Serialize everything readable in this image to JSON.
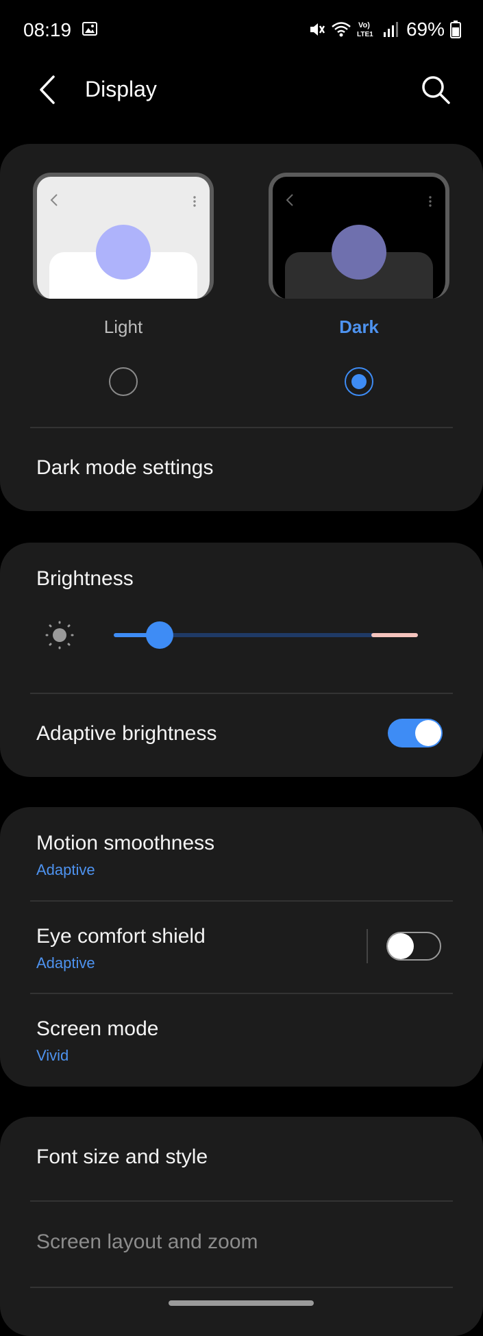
{
  "status_bar": {
    "time": "08:19",
    "battery": "69%",
    "network": "LTE1",
    "icons": [
      "gallery-icon",
      "mute-icon",
      "wifi-icon",
      "volte-icon",
      "signal-icon",
      "battery-icon"
    ]
  },
  "header": {
    "title": "Display",
    "back_icon": "back-arrow-icon",
    "search_icon": "search-icon"
  },
  "theme": {
    "light_label": "Light",
    "dark_label": "Dark",
    "selected": "Dark",
    "settings_label": "Dark mode settings"
  },
  "brightness": {
    "title": "Brightness",
    "level": 0.15,
    "adaptive_label": "Adaptive brightness",
    "adaptive_on": true
  },
  "motion": {
    "title": "Motion smoothness",
    "value": "Adaptive"
  },
  "eye_comfort": {
    "title": "Eye comfort shield",
    "value": "Adaptive",
    "on": false
  },
  "screen_mode": {
    "title": "Screen mode",
    "value": "Vivid"
  },
  "more": {
    "font_label": "Font size and style",
    "layout_label": "Screen layout and zoom"
  },
  "colors": {
    "background": "#000000",
    "card": "#1c1c1c",
    "accent": "#3e8cf5",
    "subtext": "#4e93f0"
  }
}
